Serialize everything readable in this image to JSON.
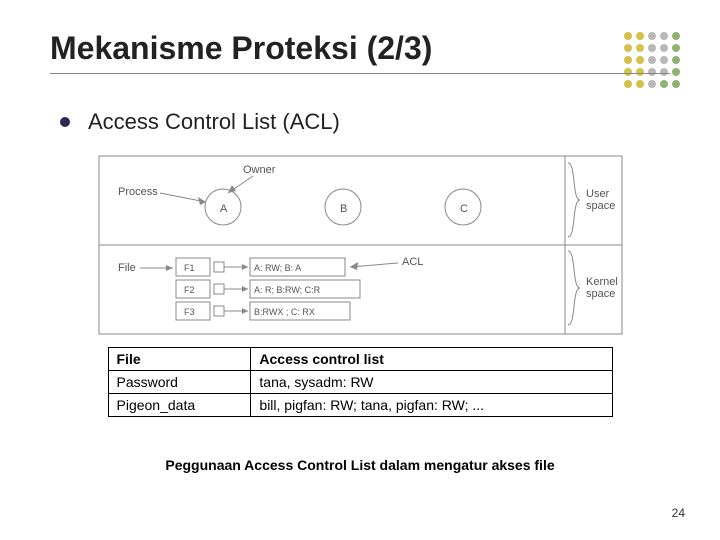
{
  "title": "Mekanisme Proteksi (2/3)",
  "bullet": "Access Control List (ACL)",
  "diagram": {
    "processLabel": "Process",
    "ownerLabel": "Owner",
    "nodes": {
      "a": "A",
      "b": "B",
      "c": "C"
    },
    "fileLabel": "File",
    "aclLabel": "ACL",
    "files": {
      "f1": "F1",
      "f2": "F2",
      "f3": "F3"
    },
    "aclRows": {
      "r1": "A: RW;   B: A",
      "r2": "A: R;  B:RW;  C:R",
      "r3": "B:RWX ; C: RX"
    },
    "userSpace": "User space",
    "kernelSpace": "Kernel space"
  },
  "table": {
    "headers": {
      "file": "File",
      "acl": "Access control list"
    },
    "rows": [
      {
        "file": "Password",
        "acl": "tana, sysadm: RW"
      },
      {
        "file": "Pigeon_data",
        "acl": "bill, pigfan: RW;  tana, pigfan: RW; ..."
      }
    ]
  },
  "caption": "Peggunaan Access Control List dalam mengatur akses file",
  "pageNumber": "24"
}
